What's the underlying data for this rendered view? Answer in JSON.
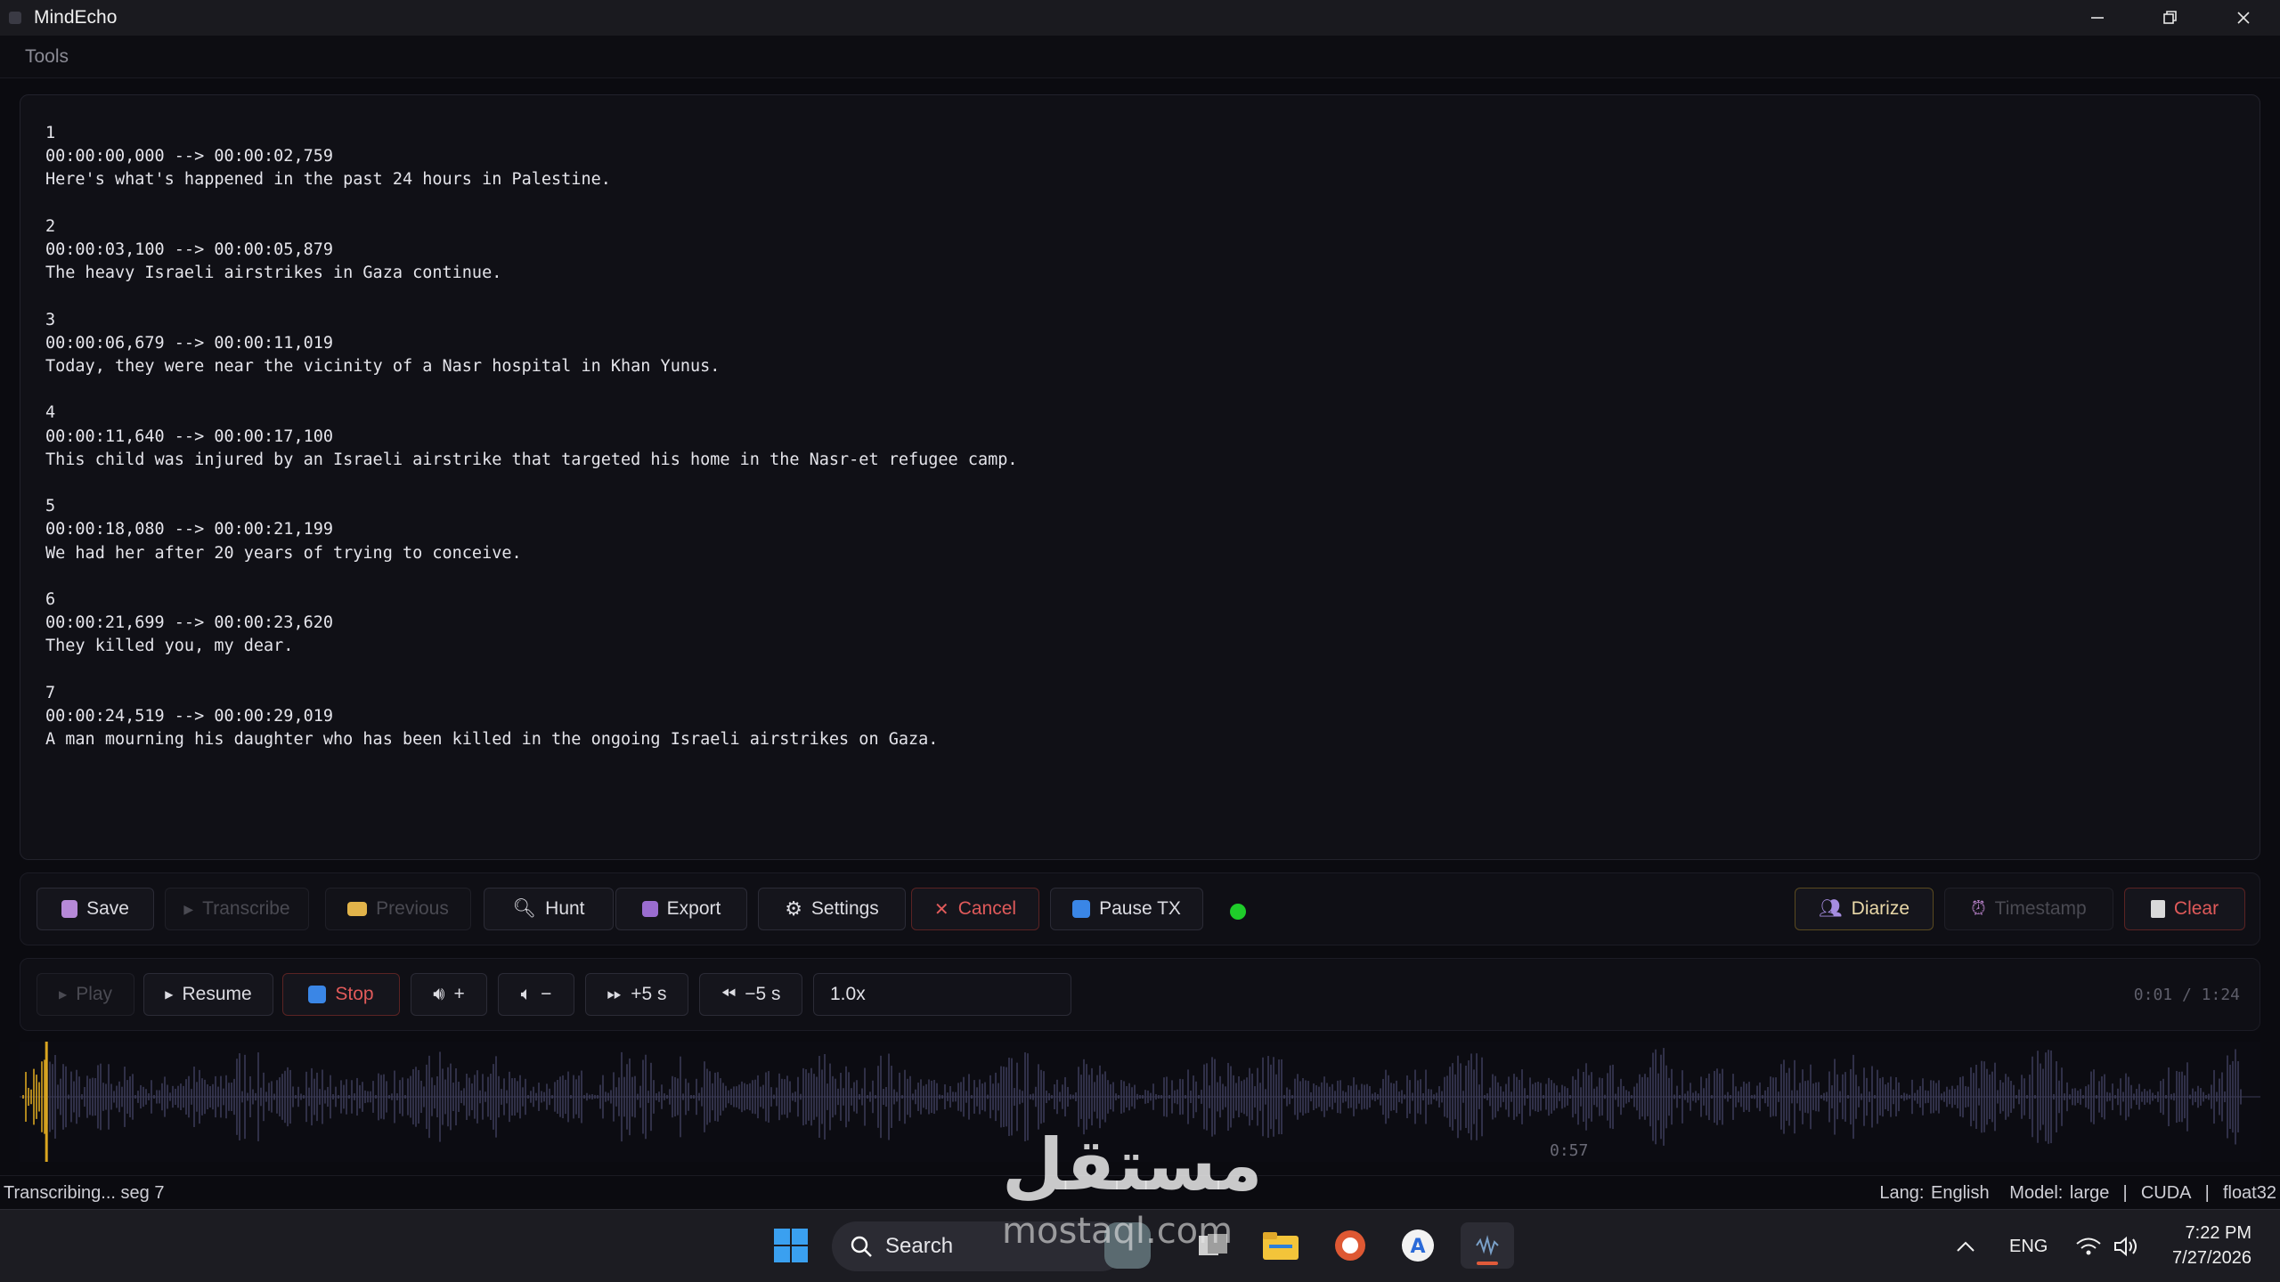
{
  "window": {
    "title": "MindEcho",
    "minimize": "─",
    "restore": "❐",
    "close": "✕"
  },
  "menu": {
    "tools": "Tools"
  },
  "transcript": [
    {
      "index": "1",
      "time": "00:00:00,000 --> 00:00:02,759",
      "text": "Here's what's happened in the past 24 hours in Palestine."
    },
    {
      "index": "2",
      "time": "00:00:03,100 --> 00:00:05,879",
      "text": "The heavy Israeli airstrikes in Gaza continue."
    },
    {
      "index": "3",
      "time": "00:00:06,679 --> 00:00:11,019",
      "text": "Today, they were near the vicinity of a Nasr hospital in Khan Yunus."
    },
    {
      "index": "4",
      "time": "00:00:11,640 --> 00:00:17,100",
      "text": "This child was injured by an Israeli airstrike that targeted his home in the Nasr-et refugee camp."
    },
    {
      "index": "5",
      "time": "00:00:18,080 --> 00:00:21,199",
      "text": "We had her after 20 years of trying to conceive."
    },
    {
      "index": "6",
      "time": "00:00:21,699 --> 00:00:23,620",
      "text": "They killed you, my dear."
    },
    {
      "index": "7",
      "time": "00:00:24,519 --> 00:00:29,019",
      "text": "A man mourning his daughter who has been killed in the ongoing Israeli airstrikes on Gaza."
    }
  ],
  "toolbar": {
    "save": "Save",
    "transcribe": "Transcribe",
    "previous": "Previous",
    "hunt": "Hunt",
    "export": "Export",
    "settings": "Settings",
    "cancel": "Cancel",
    "pause_tx": "Pause TX",
    "diarize": "Diarize",
    "timestamp": "Timestamp",
    "clear": "Clear",
    "status_color": "#1fcc2a"
  },
  "player": {
    "play": "Play",
    "resume": "Resume",
    "stop": "Stop",
    "vol_up": "+",
    "vol_down": "−",
    "fwd": "+5 s",
    "back": "−5 s",
    "speed": "1.0x",
    "timecode": "0:01 / 1:24",
    "wave_time": "0:57",
    "progress_fraction": 0.012
  },
  "status": {
    "left": "Transcribing... seg 7",
    "lang": "Lang: English",
    "model": "Model: large",
    "device": "CUDA",
    "dtype": "float32",
    "sep": "|"
  },
  "taskbar": {
    "search": "Search",
    "lang": "ENG",
    "time": "7:22 PM",
    "date": "7/27/2026",
    "watermark": "مستقل",
    "watermark_latin": "mostaql.com"
  },
  "colors": {
    "accent_red": "#e05a5a",
    "accent_gold": "#e9d8a8",
    "wave": "#3a3a55",
    "wave_played": "#d9a520"
  }
}
